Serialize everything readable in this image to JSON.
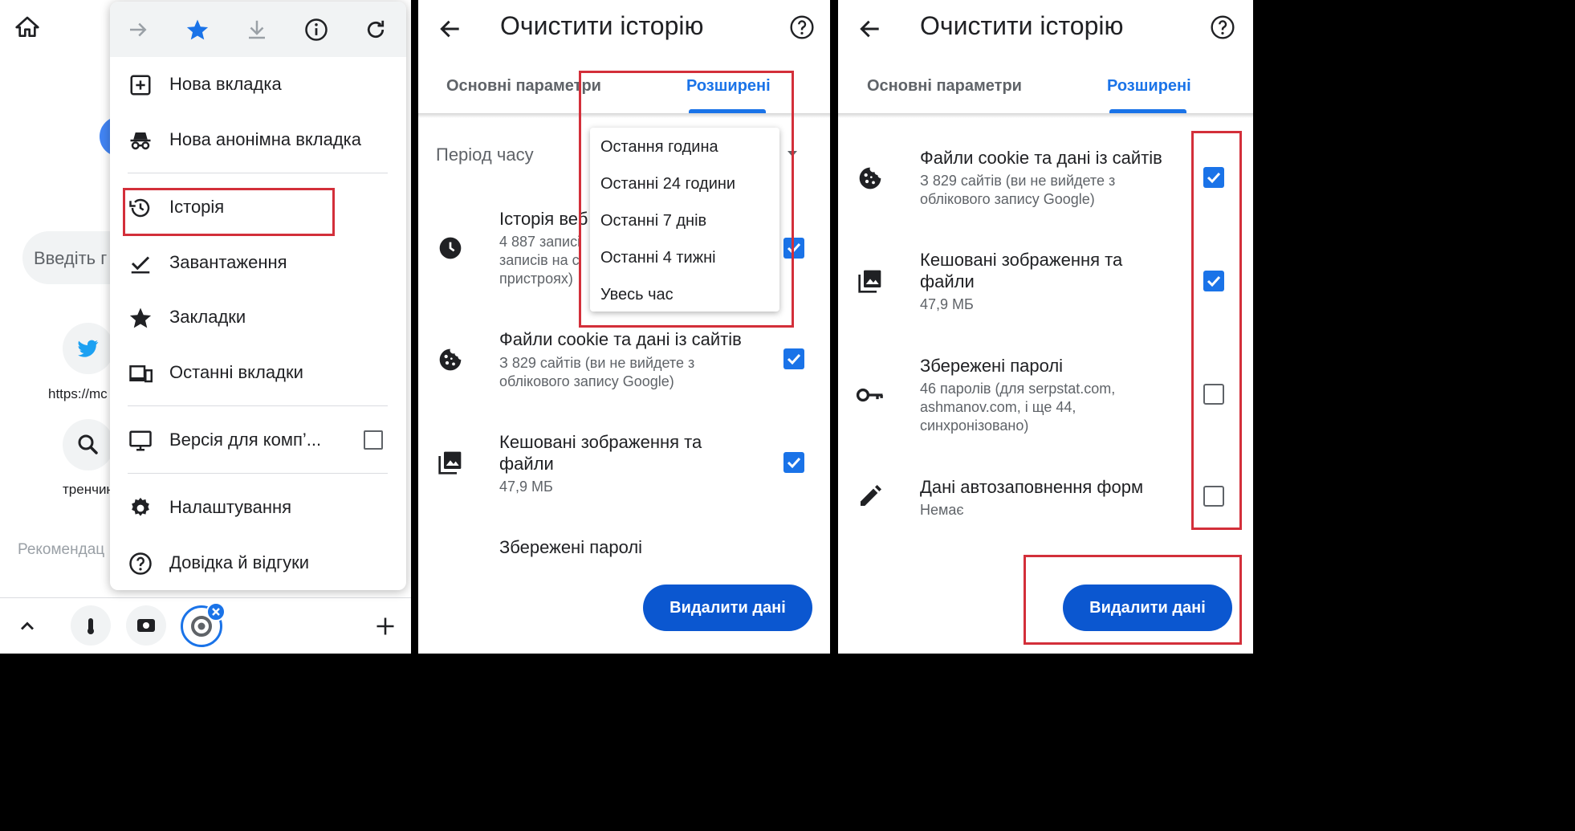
{
  "colors": {
    "accent": "#1a73e8",
    "button": "#0b57d0",
    "highlight": "#d32f3a"
  },
  "panel1": {
    "bg": {
      "input_placeholder": "Введіть г",
      "shortcut1_label": "https://mc",
      "shortcut2_label": "тренчин",
      "recommended_label": "Рекомендац"
    },
    "toolbar_icons": [
      "forward-icon",
      "star-icon",
      "download-icon",
      "info-icon",
      "refresh-icon"
    ],
    "menu": {
      "new_tab": "Нова вкладка",
      "incognito": "Нова анонімна вкладка",
      "history": "Історія",
      "downloads": "Завантаження",
      "bookmarks": "Закладки",
      "recent_tabs": "Останні вкладки",
      "desktop_site": "Версія для комп’...",
      "settings": "Налаштування",
      "help": "Довідка й відгуки"
    },
    "bottom_bar_icons": [
      "chevron-up-icon",
      "tab-icon",
      "tab-icon",
      "chrome-icon",
      "plus-icon"
    ]
  },
  "panel2": {
    "title": "Очистити історію",
    "tabs": {
      "basic": "Основні параметри",
      "advanced": "Розширені"
    },
    "time_range_label": "Період часу",
    "time_range_options": [
      "Остання година",
      "Останні 24 години",
      "Останні 7 днів",
      "Останні 4 тижні",
      "Увесь час"
    ],
    "history": {
      "title": "Історія веб",
      "sub1": "4 887 записі",
      "sub2": "записів на с",
      "sub3": "пристроях)"
    },
    "cookies": {
      "title": "Файли cookie та дані із сайтів",
      "sub1": "З 829 сайтів (ви не вийдете з",
      "sub2": "облікового запису Google)"
    },
    "cache": {
      "title1": "Кешовані зображення та",
      "title2": "файли",
      "sub": "47,9 МБ"
    },
    "passwords": {
      "title": "Збережені паролі"
    },
    "delete_button": "Видалити дані"
  },
  "panel3": {
    "title": "Очистити історію",
    "tabs": {
      "basic": "Основні параметри",
      "advanced": "Розширені"
    },
    "cookies": {
      "title": "Файли cookie та дані із сайтів",
      "sub1": "З 829 сайтів (ви не вийдете з",
      "sub2": "облікового запису Google)",
      "checked": true
    },
    "cache": {
      "title1": "Кешовані зображення та",
      "title2": "файли",
      "sub": "47,9 МБ",
      "checked": true
    },
    "passwords": {
      "title": "Збережені паролі",
      "sub1": "46 паролів (для serpstat.com,",
      "sub2": "ashmanov.com, і ще 44,",
      "sub3": "синхронізовано)",
      "checked": false
    },
    "autofill": {
      "title": "Дані автозаповнення форм",
      "sub": "Немає",
      "checked": false
    },
    "delete_button": "Видалити дані"
  }
}
